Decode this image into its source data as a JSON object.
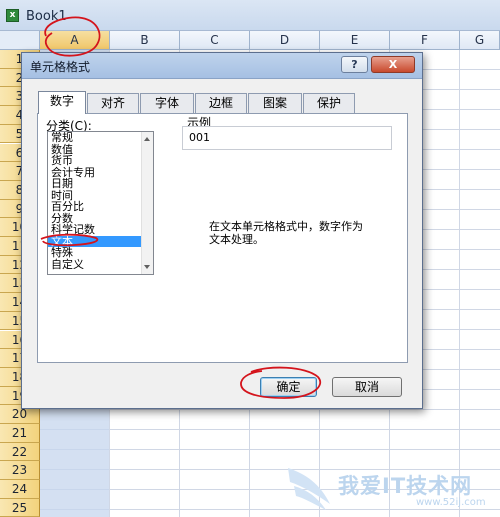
{
  "workbook": {
    "icon": "excel-workbook-icon",
    "title": "Book1",
    "columns": [
      "A",
      "B",
      "C",
      "D",
      "E",
      "F",
      "G"
    ],
    "selected_column": "A",
    "rows": [
      "1",
      "2",
      "3",
      "4",
      "5",
      "6",
      "7",
      "8",
      "9",
      "10",
      "11",
      "12",
      "13",
      "14",
      "15",
      "16",
      "17",
      "18",
      "19",
      "20",
      "21",
      "22",
      "23",
      "24",
      "25"
    ]
  },
  "dialog": {
    "title": "单元格格式",
    "help_label": "?",
    "close_label": "X",
    "tabs": [
      "数字",
      "对齐",
      "字体",
      "边框",
      "图案",
      "保护"
    ],
    "active_tab": "数字",
    "category_label": "分类(C):",
    "categories": [
      "常规",
      "数值",
      "货币",
      "会计专用",
      "日期",
      "时间",
      "百分比",
      "分数",
      "科学记数",
      "文本",
      "特殊",
      "自定义"
    ],
    "selected_category": "文本",
    "sample_label": "示例",
    "sample_value": "001",
    "description": "在文本单元格格式中，数字作为\n文本处理。",
    "ok_label": "确定",
    "cancel_label": "取消"
  },
  "watermark": {
    "text": "我爱IT技术网",
    "url": "www.52ij.com"
  },
  "colors": {
    "annotation_red": "#d4141c",
    "selection_blue": "#3399ff",
    "row_header": "#f3d37d"
  }
}
